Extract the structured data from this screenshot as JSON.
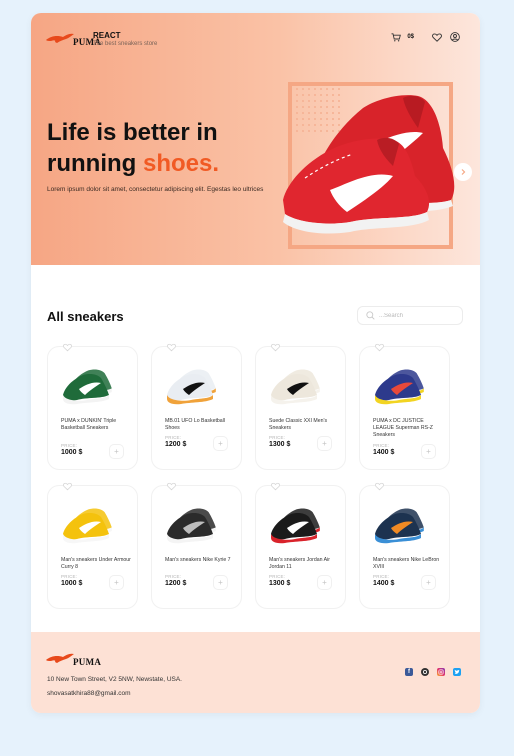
{
  "header": {
    "logo_text": "PUMA",
    "brand_title": "REACT",
    "brand_subtitle": "The best sneakers store",
    "cart_total": "0$"
  },
  "hero": {
    "headline_line1": "Life is better in",
    "headline_line2_start": "running ",
    "headline_accent": "shoes.",
    "description": "Lorem ipsum dolor sit amet, consectetur adipiscing elit. Egestas leo ultrices"
  },
  "catalog": {
    "title": "All sneakers",
    "search_placeholder": "...Search",
    "price_label": "PRICE:",
    "add_label": "+",
    "products": [
      {
        "name": "PUMA x DUNKIN' Triple Basketball Sneakers",
        "price": "1000 $"
      },
      {
        "name": "MB.01 UFO Lo Basketball Shoes",
        "price": "1200 $"
      },
      {
        "name": "Suede Classic XXI Men's Sneakers",
        "price": "1300 $"
      },
      {
        "name": "PUMA x DC JUSTICE LEAGUE Superman RS-Z Sneakers",
        "price": "1400 $"
      },
      {
        "name": "Man's sneakers Under Armour Curry 8",
        "price": "1000 $"
      },
      {
        "name": "Man's sneakers Nike Kyrie 7",
        "price": "1200 $"
      },
      {
        "name": "Man's sneakers Jordan Air Jordan 11",
        "price": "1300 $"
      },
      {
        "name": "Man's sneakers Nike LeBron XVIII",
        "price": "1400 $"
      }
    ]
  },
  "footer": {
    "logo_text": "PUMA",
    "address": "10 New Town Street, V2 5NW, Newstate, USA.",
    "email": "shovasatkhira88@gmail.com",
    "socials": [
      "facebook-icon",
      "github-icon",
      "instagram-icon",
      "twitter-icon"
    ]
  },
  "colors": {
    "accent": "#f15a24",
    "hero_gradient_start": "#f6a684",
    "footer_bg": "#fde1d5",
    "page_bg": "#e6f2fc"
  }
}
